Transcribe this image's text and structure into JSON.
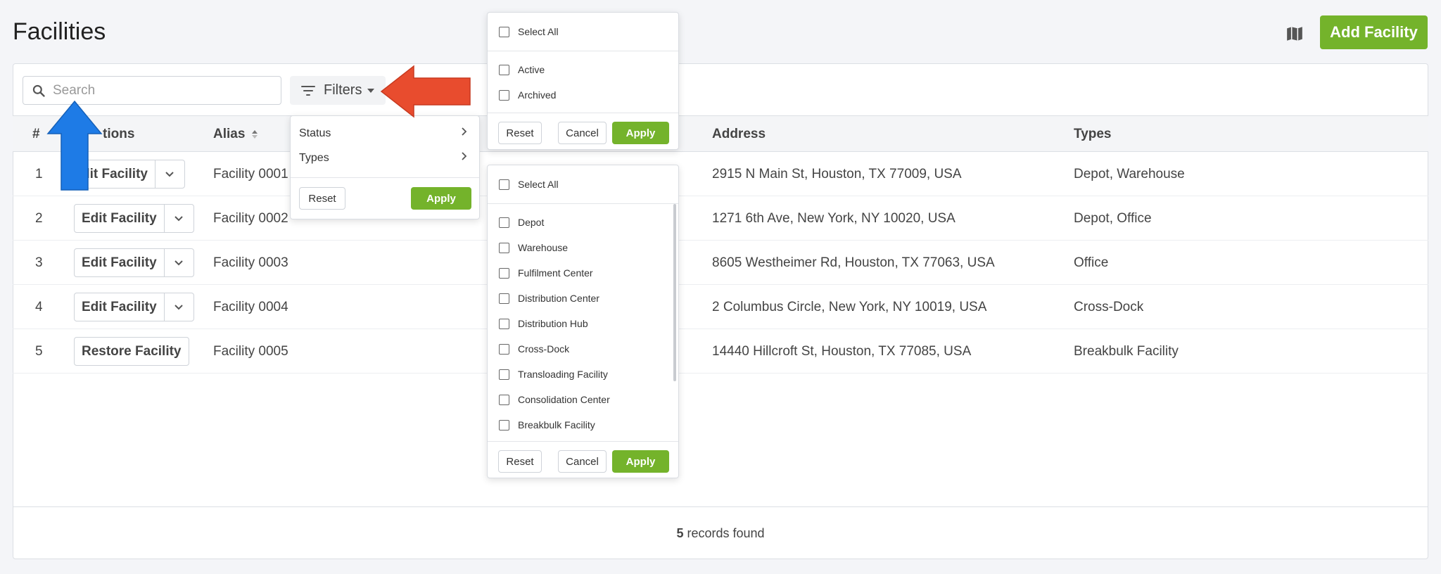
{
  "header": {
    "title": "Facilities",
    "map_icon": "map-icon",
    "add_button": "Add Facility"
  },
  "toolbar": {
    "search_placeholder": "Search",
    "search_value": "",
    "filters_label": "Filters"
  },
  "table": {
    "headers": {
      "num": "#",
      "actions": "tions",
      "alias": "Alias",
      "address": "Address",
      "types": "Types"
    },
    "rows": [
      {
        "num": "1",
        "action": "dit Facility",
        "alias": "Facility 0001",
        "address": "2915 N Main St, Houston, TX 77009, USA",
        "types": "Depot, Warehouse"
      },
      {
        "num": "2",
        "action": "Edit Facility",
        "alias": "Facility 0002",
        "address": "1271 6th Ave, New York, NY 10020, USA",
        "types": "Depot, Office"
      },
      {
        "num": "3",
        "action": "Edit Facility",
        "alias": "Facility 0003",
        "address": "8605 Westheimer Rd, Houston, TX 77063, USA",
        "types": "Office"
      },
      {
        "num": "4",
        "action": "Edit Facility",
        "alias": "Facility 0004",
        "address": "2 Columbus Circle, New York, NY 10019, USA",
        "types": "Cross-Dock"
      },
      {
        "num": "5",
        "action": "Restore Facility",
        "alias": "Facility 0005",
        "address": "14440 Hillcroft St, Houston, TX 77085, USA",
        "types": "Breakbulk Facility"
      }
    ]
  },
  "footer": {
    "count": "5",
    "text": " records found"
  },
  "filter_menu": {
    "items": [
      "Status",
      "Types"
    ],
    "reset": "Reset",
    "apply": "Apply"
  },
  "status_panel": {
    "select_all": "Select All",
    "options": [
      "Active",
      "Archived"
    ],
    "reset": "Reset",
    "cancel": "Cancel",
    "apply": "Apply"
  },
  "types_panel": {
    "select_all": "Select All",
    "options": [
      "Depot",
      "Warehouse",
      "Fulfilment Center",
      "Distribution Center",
      "Distribution Hub",
      "Cross-Dock",
      "Transloading Facility",
      "Consolidation Center",
      "Breakbulk Facility"
    ],
    "reset": "Reset",
    "cancel": "Cancel",
    "apply": "Apply"
  },
  "colors": {
    "accent_green": "#74b32b",
    "arrow_red": "#e84c2e",
    "arrow_blue": "#1e7be6"
  }
}
